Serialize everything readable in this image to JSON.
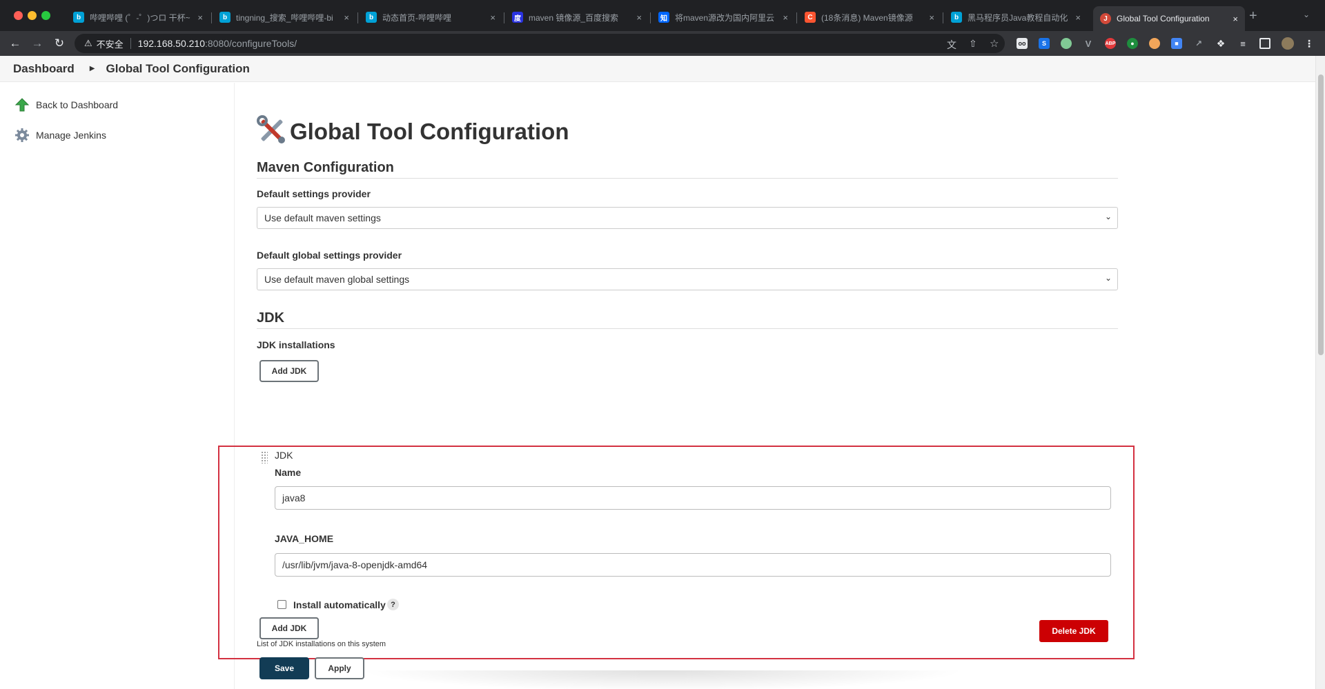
{
  "browser": {
    "tabs": [
      {
        "title": "哔哩哔哩 (゜-゜)つロ 干杯~",
        "favicon": "bilibili-icon",
        "color": "#00a1d6"
      },
      {
        "title": "tingning_搜索_哔哩哔哩-bi",
        "favicon": "bilibili-icon",
        "color": "#00a1d6"
      },
      {
        "title": "动态首页-哔哩哔哩",
        "favicon": "bilibili-icon",
        "color": "#00a1d6"
      },
      {
        "title": "maven 镜像源_百度搜索",
        "favicon": "baidu-icon",
        "color": "#2932e1"
      },
      {
        "title": "将maven源改为国内阿里云",
        "favicon": "zhihu-icon",
        "color": "#0066ff"
      },
      {
        "title": "(18条消息) Maven镜像源",
        "favicon": "csdn-icon",
        "color": "#fc5531"
      },
      {
        "title": "黑马程序员Java教程自动化",
        "favicon": "bilibili-icon",
        "color": "#00a1d6"
      },
      {
        "title": "Global Tool Configuration",
        "favicon": "jenkins-icon",
        "color": "#d24939",
        "active": true
      }
    ],
    "tab_close": "×",
    "new_tab": "+",
    "url": {
      "insecure_label": "不安全",
      "host": "192.168.50.210",
      "rest": ":8080/configureTools/"
    },
    "extensions": [
      "translate-icon",
      "share-icon",
      "bookmark-star-icon",
      "ext-eye-icon",
      "ext-s-icon",
      "ext-circle-icon",
      "ext-v-icon",
      "adblock-icon",
      "ext-green-icon",
      "ext-face-icon",
      "ext-blue-icon",
      "google-translate-icon",
      "ext-arrow-icon",
      "puzzle-icon",
      "reading-list-icon",
      "sidepanel-icon",
      "profile-avatar"
    ]
  },
  "breadcrumb": {
    "home": "Dashboard",
    "current": "Global Tool Configuration"
  },
  "sidebar": {
    "items": [
      {
        "label": "Back to Dashboard",
        "icon": "up-arrow-icon"
      },
      {
        "label": "Manage Jenkins",
        "icon": "gear-icon"
      }
    ]
  },
  "page": {
    "title": "Global Tool Configuration",
    "maven": {
      "section_title": "Maven Configuration",
      "settings_label": "Default settings provider",
      "settings_value": "Use default maven settings",
      "global_label": "Default global settings provider",
      "global_value": "Use default maven global settings"
    },
    "jdk": {
      "section_title": "JDK",
      "installations_label": "JDK installations",
      "add_button": "Add JDK",
      "entry_header": "JDK",
      "name_label": "Name",
      "name_value": "java8",
      "home_label": "JAVA_HOME",
      "home_value": "/usr/lib/jvm/java-8-openjdk-amd64",
      "install_auto_label": "Install automatically",
      "install_auto_checked": false,
      "help": "?",
      "delete_button": "Delete JDK",
      "list_hint": "List of JDK installations on this system"
    },
    "actions": {
      "save": "Save",
      "apply": "Apply"
    }
  },
  "colors": {
    "accent_blue": "#123c55",
    "danger_red": "#cc0003",
    "highlight_box": "#d33040"
  }
}
